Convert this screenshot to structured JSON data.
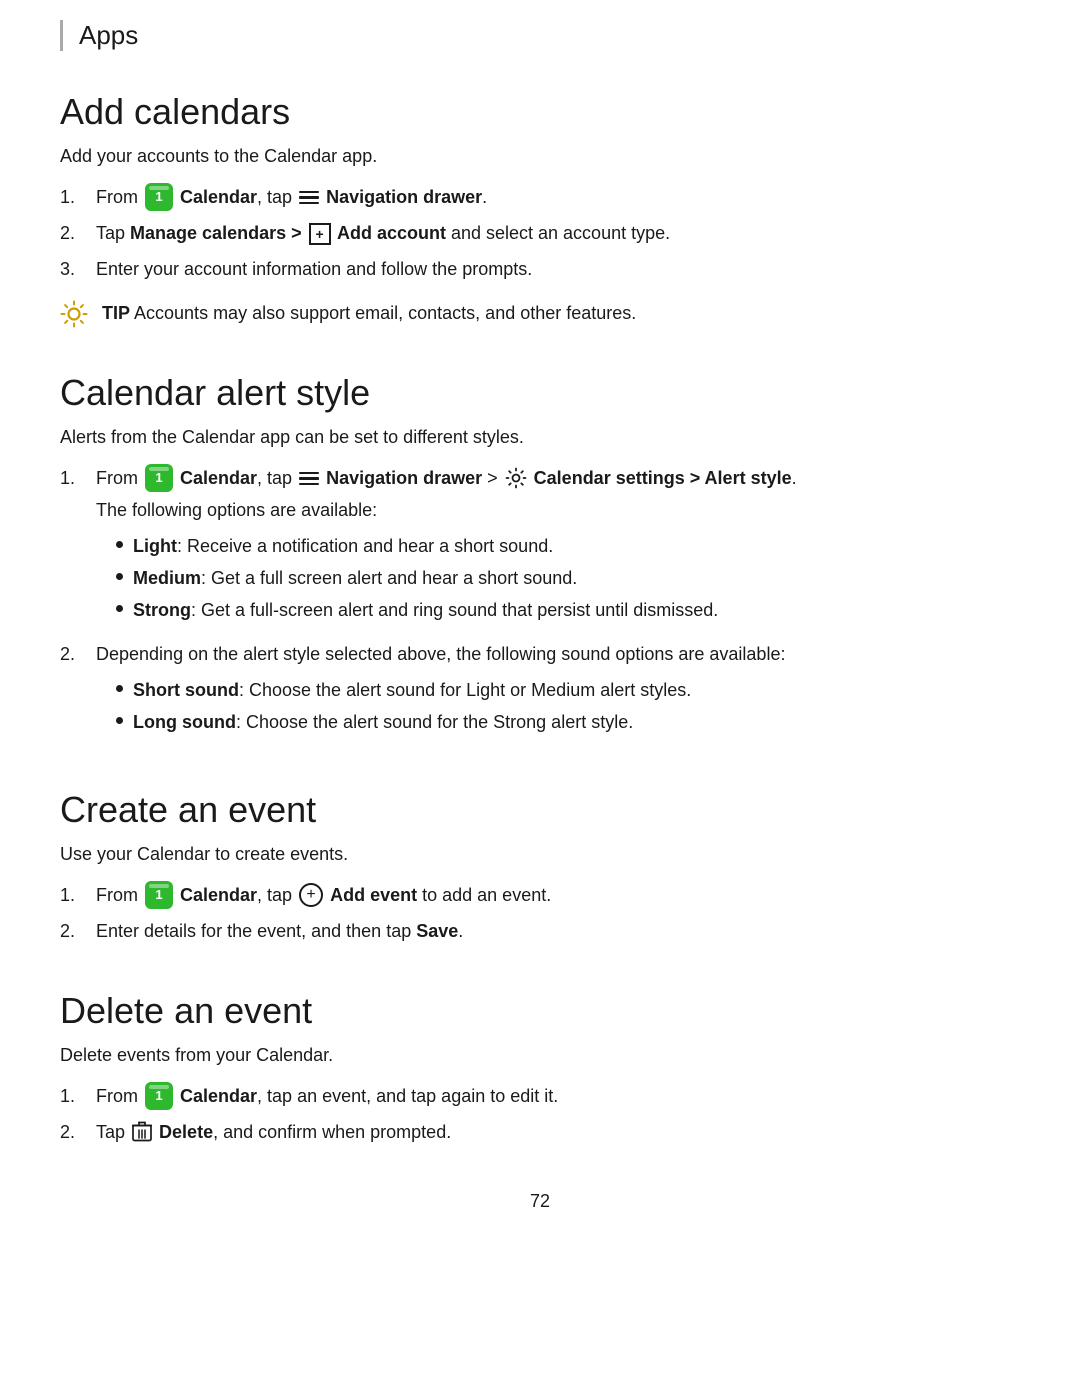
{
  "header": {
    "title": "Apps",
    "border_color": "#aaaaaa"
  },
  "sections": [
    {
      "id": "add-calendars",
      "title": "Add calendars",
      "intro": "Add your accounts to the Calendar app.",
      "steps": [
        {
          "num": "1.",
          "parts": [
            {
              "type": "text",
              "value": "From "
            },
            {
              "type": "cal-icon",
              "value": "1"
            },
            {
              "type": "bold",
              "value": " Calendar"
            },
            {
              "type": "text",
              "value": ", tap "
            },
            {
              "type": "nav-icon"
            },
            {
              "type": "bold",
              "value": " Navigation drawer"
            },
            {
              "type": "text",
              "value": "."
            }
          ]
        },
        {
          "num": "2.",
          "parts": [
            {
              "type": "text",
              "value": "Tap "
            },
            {
              "type": "bold",
              "value": "Manage calendars > "
            },
            {
              "type": "plus-box",
              "value": "+"
            },
            {
              "type": "bold",
              "value": " Add account"
            },
            {
              "type": "text",
              "value": " and select an account type."
            }
          ]
        },
        {
          "num": "3.",
          "parts": [
            {
              "type": "text",
              "value": "Enter your account information and follow the prompts."
            }
          ]
        }
      ],
      "tip": {
        "show": true,
        "text": "Accounts may also support email, contacts, and other features."
      }
    },
    {
      "id": "calendar-alert-style",
      "title": "Calendar alert style",
      "intro": "Alerts from the Calendar app can be set to different styles.",
      "steps": [
        {
          "num": "1.",
          "parts": [
            {
              "type": "text",
              "value": "From "
            },
            {
              "type": "cal-icon",
              "value": "1"
            },
            {
              "type": "bold",
              "value": " Calendar"
            },
            {
              "type": "text",
              "value": ", tap "
            },
            {
              "type": "nav-icon"
            },
            {
              "type": "bold",
              "value": " Navigation drawer"
            },
            {
              "type": "text",
              "value": " > "
            },
            {
              "type": "gear-icon"
            },
            {
              "type": "bold",
              "value": " Calendar settings > Alert style"
            },
            {
              "type": "text",
              "value": "."
            }
          ],
          "sub_text": "The following options are available:",
          "bullets": [
            {
              "bold": "Light",
              "text": ": Receive a notification and hear a short sound."
            },
            {
              "bold": "Medium",
              "text": ": Get a full screen alert and hear a short sound."
            },
            {
              "bold": "Strong",
              "text": ": Get a full-screen alert and ring sound that persist until dismissed."
            }
          ]
        },
        {
          "num": "2.",
          "parts": [
            {
              "type": "text",
              "value": "Depending on the alert style selected above, the following sound options are available:"
            }
          ],
          "bullets": [
            {
              "bold": "Short sound",
              "text": ": Choose the alert sound for Light or Medium alert styles."
            },
            {
              "bold": "Long sound",
              "text": ": Choose the alert sound for the Strong alert style."
            }
          ]
        }
      ]
    },
    {
      "id": "create-event",
      "title": "Create an event",
      "intro": "Use your Calendar to create events.",
      "steps": [
        {
          "num": "1.",
          "parts": [
            {
              "type": "text",
              "value": "From "
            },
            {
              "type": "cal-icon",
              "value": "1"
            },
            {
              "type": "bold",
              "value": " Calendar"
            },
            {
              "type": "text",
              "value": ", tap "
            },
            {
              "type": "add-circle",
              "value": "+"
            },
            {
              "type": "bold",
              "value": " Add event"
            },
            {
              "type": "text",
              "value": " to add an event."
            }
          ]
        },
        {
          "num": "2.",
          "parts": [
            {
              "type": "text",
              "value": "Enter details for the event, and then tap "
            },
            {
              "type": "bold",
              "value": "Save"
            },
            {
              "type": "text",
              "value": "."
            }
          ]
        }
      ]
    },
    {
      "id": "delete-event",
      "title": "Delete an event",
      "intro": "Delete events from your Calendar.",
      "steps": [
        {
          "num": "1.",
          "parts": [
            {
              "type": "text",
              "value": "From "
            },
            {
              "type": "cal-icon",
              "value": "1"
            },
            {
              "type": "bold",
              "value": " Calendar"
            },
            {
              "type": "text",
              "value": ", tap an event, and tap again to edit it."
            }
          ]
        },
        {
          "num": "2.",
          "parts": [
            {
              "type": "text",
              "value": "Tap "
            },
            {
              "type": "trash-icon"
            },
            {
              "type": "bold",
              "value": " Delete"
            },
            {
              "type": "text",
              "value": ", and confirm when prompted."
            }
          ]
        }
      ]
    }
  ],
  "page_number": "72"
}
